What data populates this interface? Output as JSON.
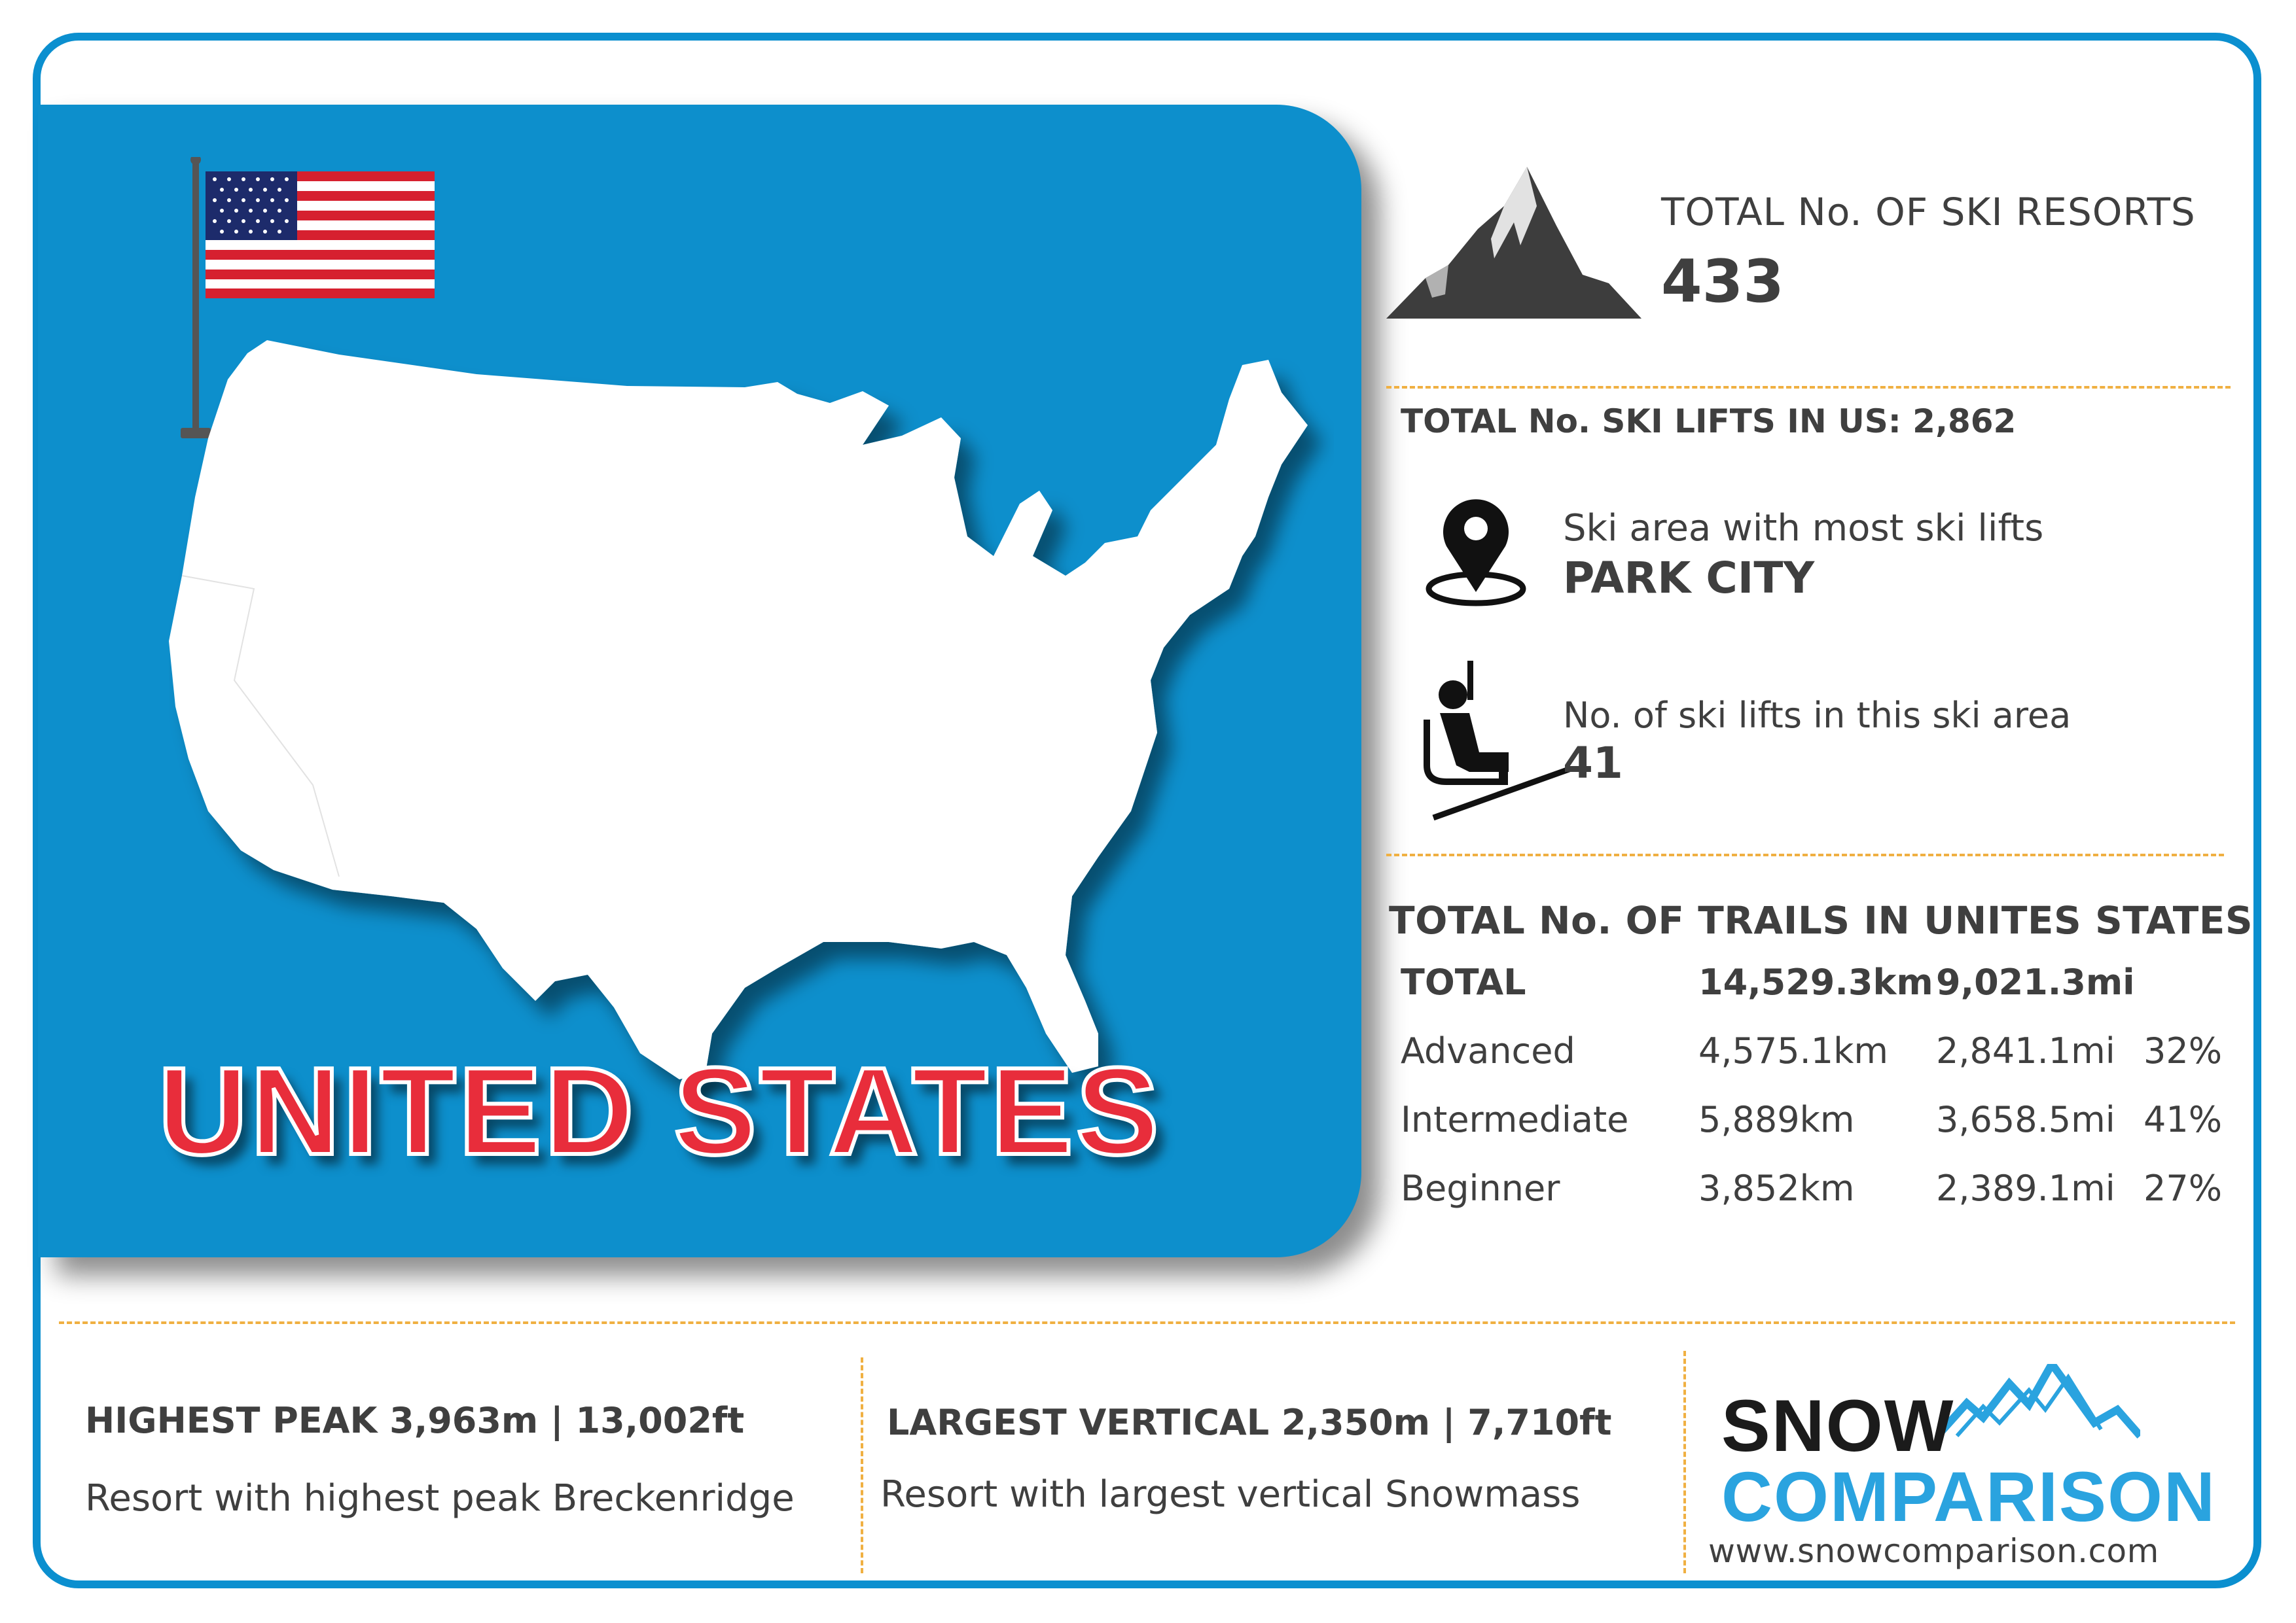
{
  "country": {
    "name": "UNITED STATES"
  },
  "colors": {
    "panel_blue": "#0d8fcc",
    "frame_blue": "#0b8fcf",
    "title_red": "#e82d3b",
    "divider_orange": "#f0b042",
    "text_dark": "#3f3f3f"
  },
  "icons": {
    "mountain": "mountain-icon",
    "pin": "location-pin-icon",
    "chairlift": "chairlift-icon",
    "flag": "us-flag-icon",
    "map": "us-map-icon"
  },
  "resorts": {
    "label": "TOTAL No. OF SKI RESORTS",
    "value": "433"
  },
  "lifts": {
    "total_label": "TOTAL No. SKI LIFTS IN US: 2,862",
    "most_label": "Ski area with most ski lifts",
    "most_value": "PARK CITY",
    "count_label": "No. of ski lifts in this ski area",
    "count_value": "41"
  },
  "trails": {
    "title": "TOTAL No. OF TRAILS IN UNITES STATES",
    "rows": [
      {
        "name": "TOTAL",
        "km": "14,529.3km",
        "mi": "9,021.3mi",
        "pct": ""
      },
      {
        "name": "Advanced",
        "km": "4,575.1km",
        "mi": "2,841.1mi",
        "pct": "32%"
      },
      {
        "name": "Intermediate",
        "km": "5,889km",
        "mi": "3,658.5mi",
        "pct": "41%"
      },
      {
        "name": "Beginner",
        "km": "3,852km",
        "mi": "2,389.1mi",
        "pct": "27%"
      }
    ]
  },
  "highest_peak": {
    "title": "HIGHEST PEAK    3,963m  |  13,002ft",
    "subtitle": "Resort with highest peak Breckenridge"
  },
  "largest_vertical": {
    "title": "LARGEST VERTICAL  2,350m | 7,710ft",
    "subtitle": "Resort with largest vertical Snowmass"
  },
  "brand": {
    "line1": "SNOW",
    "line2": "COMPARISON",
    "url": "www.snowcomparison.com"
  }
}
